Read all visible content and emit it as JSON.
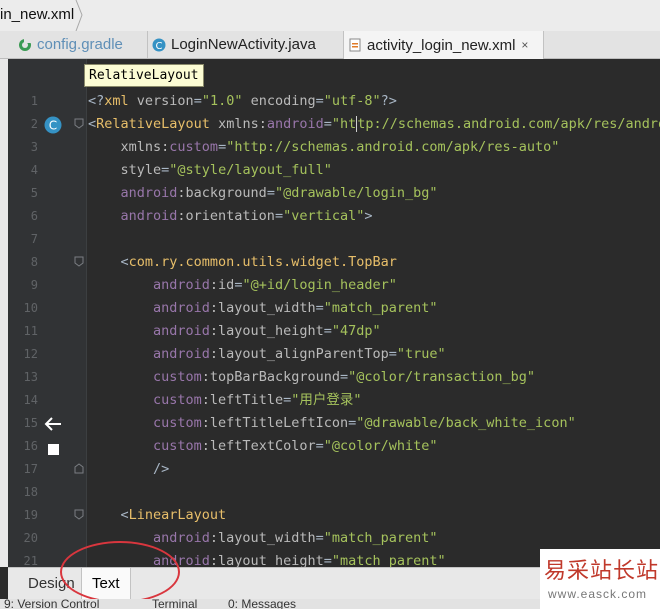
{
  "breadcrumb": {
    "file": "in_new.xml"
  },
  "tabs": [
    {
      "label": "config.gradle",
      "icon": "gradle-icon"
    },
    {
      "label": "LoginNewActivity.java",
      "icon": "java-class-icon"
    },
    {
      "label": "activity_login_new.xml",
      "icon": "xml-file-icon",
      "close": "×",
      "active": true
    }
  ],
  "editor": {
    "tooltip": "RelativeLayout",
    "lines": [
      {
        "n": "1",
        "parts": [
          [
            "punc",
            "<?"
          ],
          [
            "tag",
            "xml "
          ],
          [
            "attr",
            "version"
          ],
          [
            "punc",
            "="
          ],
          [
            "val",
            "\"1.0\""
          ],
          [
            "attr",
            " encoding"
          ],
          [
            "punc",
            "="
          ],
          [
            "val",
            "\"utf-8\""
          ],
          [
            "punc",
            "?>"
          ]
        ]
      },
      {
        "n": "2",
        "parts": [
          [
            "punc",
            "<"
          ],
          [
            "tag",
            "RelativeLayout "
          ],
          [
            "attr",
            "xmlns:"
          ],
          [
            "ns",
            "android"
          ],
          [
            "punc",
            "="
          ],
          [
            "val",
            "\"ht"
          ],
          [
            "caret",
            ""
          ],
          [
            "val",
            "tp://schemas.android.com/apk/res/android\""
          ]
        ]
      },
      {
        "n": "3",
        "parts": [
          [
            "attr",
            "    xmlns:"
          ],
          [
            "ns",
            "custom"
          ],
          [
            "punc",
            "="
          ],
          [
            "val",
            "\"http://schemas.android.com/apk/res-auto\""
          ]
        ]
      },
      {
        "n": "4",
        "parts": [
          [
            "attr",
            "    style"
          ],
          [
            "punc",
            "="
          ],
          [
            "val",
            "\"@style/layout_full\""
          ]
        ]
      },
      {
        "n": "5",
        "parts": [
          [
            "ns",
            "    android"
          ],
          [
            "attr",
            ":background"
          ],
          [
            "punc",
            "="
          ],
          [
            "val",
            "\"@drawable/login_bg\""
          ]
        ]
      },
      {
        "n": "6",
        "parts": [
          [
            "ns",
            "    android"
          ],
          [
            "attr",
            ":orientation"
          ],
          [
            "punc",
            "="
          ],
          [
            "val",
            "\"vertical\""
          ],
          [
            "punc",
            ">"
          ]
        ]
      },
      {
        "n": "7",
        "parts": []
      },
      {
        "n": "8",
        "parts": [
          [
            "punc",
            "    <"
          ],
          [
            "tag",
            "com.ry.common.utils.widget.TopBar"
          ]
        ]
      },
      {
        "n": "9",
        "parts": [
          [
            "ns",
            "        android"
          ],
          [
            "attr",
            ":id"
          ],
          [
            "punc",
            "="
          ],
          [
            "val",
            "\"@+id/login_header\""
          ]
        ]
      },
      {
        "n": "10",
        "parts": [
          [
            "ns",
            "        android"
          ],
          [
            "attr",
            ":layout_width"
          ],
          [
            "punc",
            "="
          ],
          [
            "val",
            "\"match_parent\""
          ]
        ]
      },
      {
        "n": "11",
        "parts": [
          [
            "ns",
            "        android"
          ],
          [
            "attr",
            ":layout_height"
          ],
          [
            "punc",
            "="
          ],
          [
            "val",
            "\"47dp\""
          ]
        ]
      },
      {
        "n": "12",
        "parts": [
          [
            "ns",
            "        android"
          ],
          [
            "attr",
            ":layout_alignParentTop"
          ],
          [
            "punc",
            "="
          ],
          [
            "val",
            "\"true\""
          ]
        ]
      },
      {
        "n": "13",
        "parts": [
          [
            "ns",
            "        custom"
          ],
          [
            "attr",
            ":topBarBackground"
          ],
          [
            "punc",
            "="
          ],
          [
            "val",
            "\"@color/transaction_bg\""
          ]
        ]
      },
      {
        "n": "14",
        "parts": [
          [
            "ns",
            "        custom"
          ],
          [
            "attr",
            ":leftTitle"
          ],
          [
            "punc",
            "="
          ],
          [
            "val",
            "\"用户登录\""
          ]
        ]
      },
      {
        "n": "15",
        "parts": [
          [
            "ns",
            "        custom"
          ],
          [
            "attr",
            ":leftTitleLeftIcon"
          ],
          [
            "punc",
            "="
          ],
          [
            "val",
            "\"@drawable/back_white_icon\""
          ]
        ]
      },
      {
        "n": "16",
        "parts": [
          [
            "ns",
            "        custom"
          ],
          [
            "attr",
            ":leftTextColor"
          ],
          [
            "punc",
            "="
          ],
          [
            "val",
            "\"@color/white\""
          ]
        ]
      },
      {
        "n": "17",
        "parts": [
          [
            "punc",
            "        />"
          ]
        ]
      },
      {
        "n": "18",
        "parts": []
      },
      {
        "n": "19",
        "parts": [
          [
            "punc",
            "    <"
          ],
          [
            "tag",
            "LinearLayout"
          ]
        ]
      },
      {
        "n": "20",
        "parts": [
          [
            "ns",
            "        android"
          ],
          [
            "attr",
            ":layout_width"
          ],
          [
            "punc",
            "="
          ],
          [
            "val",
            "\"match_parent\""
          ]
        ]
      },
      {
        "n": "21",
        "parts": [
          [
            "ns",
            "        android"
          ],
          [
            "attr",
            ":layout_height"
          ],
          [
            "punc",
            "="
          ],
          [
            "val",
            "\"match_parent\""
          ]
        ]
      }
    ]
  },
  "bottom_tabs": [
    {
      "label": "Design",
      "active": false
    },
    {
      "label": "Text",
      "active": true
    }
  ],
  "status_bar": [
    {
      "label": "9: Version Control"
    },
    {
      "label": "Terminal"
    },
    {
      "label": "0: Messages"
    }
  ],
  "watermark": {
    "chinese": "易采站长站",
    "url": "www.easck.com"
  },
  "colors": {
    "tag": "#e8bf6a",
    "value": "#a5c25c",
    "namespace": "#9876aa",
    "annotation": "#d9363e"
  }
}
